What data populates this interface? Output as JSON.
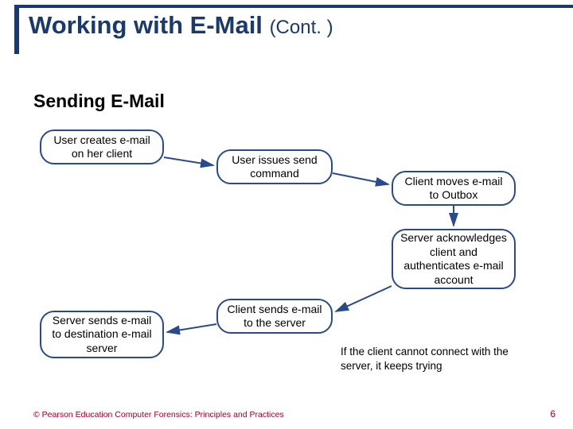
{
  "title_main": "Working with E-Mail",
  "title_cont": "(Cont. )",
  "subtitle": "Sending E-Mail",
  "steps": {
    "s1": "User creates e-mail on her client",
    "s2": "User issues send command",
    "s3": "Client moves e-mail to Outbox",
    "s4": "Server acknowledges client and authenticates e-mail account",
    "s5": "Client sends e-mail to the server",
    "s6": "Server sends e-mail to destination e-mail server"
  },
  "caption": "If the client cannot connect with the server, it keeps trying",
  "footer": "© Pearson Education  Computer Forensics: Principles and Practices",
  "page_number": "6"
}
